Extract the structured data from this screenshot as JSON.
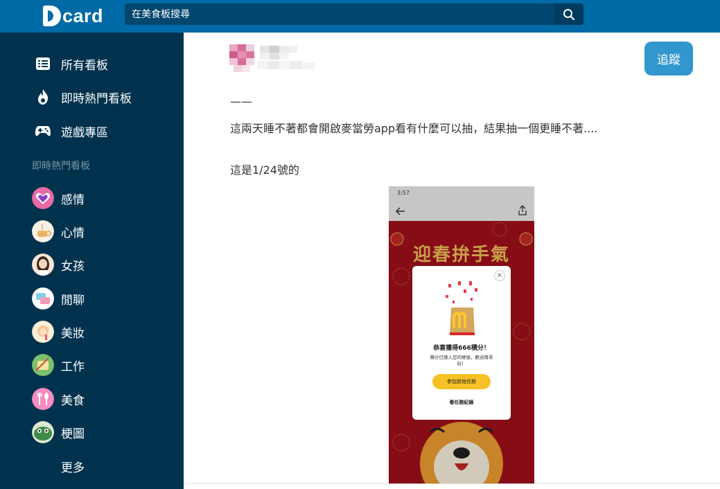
{
  "header": {
    "logo_text": "card",
    "search_placeholder": "在美食板搜尋"
  },
  "sidebar": {
    "main_items": [
      {
        "label": "所有看板",
        "icon": "list-icon"
      },
      {
        "label": "即時熱門看板",
        "icon": "flame-icon"
      },
      {
        "label": "遊戲專區",
        "icon": "gamepad-icon"
      }
    ],
    "section_title": "即時熱門看板",
    "boards": [
      {
        "label": "感情",
        "icon": "heart-board-avatar",
        "color": "#e86aa6"
      },
      {
        "label": "心情",
        "icon": "coffee-board-avatar",
        "color": "#f5e6c8"
      },
      {
        "label": "女孩",
        "icon": "girl-board-avatar",
        "color": "#fbe6d6"
      },
      {
        "label": "閒聊",
        "icon": "chat-board-avatar",
        "color": "#cfeaf5"
      },
      {
        "label": "美妝",
        "icon": "makeup-board-avatar",
        "color": "#fdeed8"
      },
      {
        "label": "工作",
        "icon": "work-board-avatar",
        "color": "#7cc16b"
      },
      {
        "label": "美食",
        "icon": "food-board-avatar",
        "color": "#f48cc0"
      },
      {
        "label": "梗圖",
        "icon": "meme-board-avatar",
        "color": "#3f8c4a"
      }
    ],
    "more_label": "更多"
  },
  "post": {
    "follow_label": "追蹤",
    "lines": [
      "——",
      "這兩天睡不著都會開啟麥當勞app看有什麼可以抽，結果抽一個更睡不著....",
      "這是1/24號的"
    ]
  },
  "screenshot": {
    "status_time": "3:57",
    "banner_title": "迎春拚手氣",
    "modal_title": "恭喜獲得666積分！",
    "modal_subtitle": "積分已匯入您的帳號，歡迎再來玩！",
    "modal_button": "參加其他任務",
    "modal_link": "看任務紀錄",
    "close_glyph": "×"
  },
  "colors": {
    "header_bg": "#006aa6",
    "sidebar_bg": "#00324e",
    "follow_bg": "#3397cf",
    "phone_red": "#a4111c"
  }
}
